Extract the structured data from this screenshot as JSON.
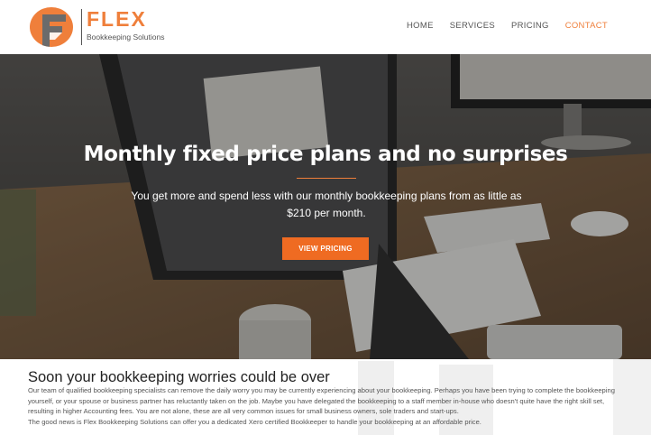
{
  "brand": {
    "name": "FLEX",
    "tagline": "Bookkeeping Solutions",
    "accent_color": "#ef7f3b"
  },
  "nav": {
    "items": [
      {
        "label": "HOME"
      },
      {
        "label": "SERVICES"
      },
      {
        "label": "PRICING"
      },
      {
        "label": "CONTACT"
      }
    ],
    "active": "CONTACT"
  },
  "hero": {
    "title": "Monthly fixed price plans and no surprises",
    "subtitle": "You get more and spend less with our monthly bookkeeping plans from as little as $210 per month.",
    "button_label": "VIEW PRICING",
    "button_color": "#ef6b22"
  },
  "intro": {
    "heading": "Soon your bookkeeping worries could be over",
    "paragraph_1": "Our team of qualified bookkeeping specialists can remove the daily worry you may be currently experiencing about your bookkeeping. Perhaps you have been trying to complete the bookkeeping yourself, or your spouse or business partner has reluctantly taken on the job. Maybe you have delegated the bookkeeping to a staff member in-house who doesn't quite have the right skill set, resulting in higher Accounting fees. You are not alone, these are all very common issues for small business owners, sole traders and start-ups.",
    "paragraph_2": "The good news is Flex Bookkeeping Solutions can offer you a dedicated Xero certified Bookkeeper to handle your bookkeeping at an affordable price."
  }
}
